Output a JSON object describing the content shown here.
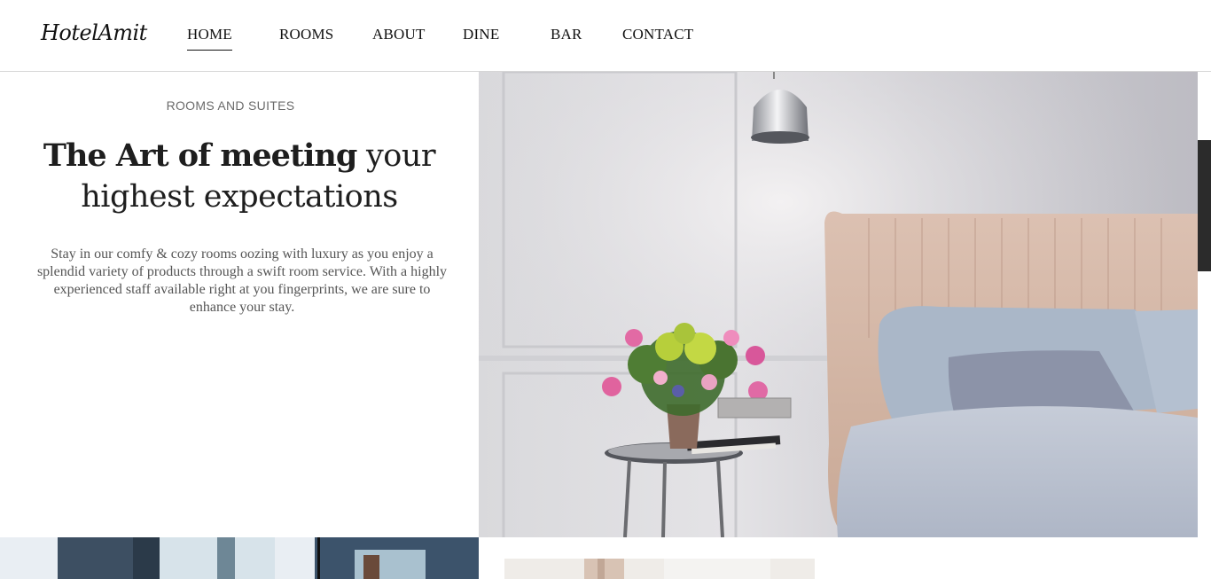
{
  "brand": {
    "logo_text": "HotelAmit"
  },
  "nav": {
    "items": [
      {
        "label": "HOME",
        "active": true
      },
      {
        "label": "ROOMS",
        "active": false
      },
      {
        "label": "ABOUT",
        "active": false
      },
      {
        "label": "DINE",
        "active": false
      },
      {
        "label": "BAR",
        "active": false
      },
      {
        "label": "CONTACT",
        "active": false
      }
    ]
  },
  "intro": {
    "eyebrow": "ROOMS AND SUITES",
    "headline_bold": "The Art of meeting",
    "headline_light_1": " your",
    "headline_light_2": "highest expectations",
    "body": "Stay in our comfy & cozy rooms oozing with luxury as you enjoy a splendid variety of products through a swift room service. With a highly experienced staff available right at you fingerprints, we are sure to enhance your stay."
  },
  "colors": {
    "text_dark": "#1e1e1e",
    "text_muted": "#6b6b6b",
    "divider": "#d6d6d6",
    "side_tab": "#2b2b2b"
  }
}
